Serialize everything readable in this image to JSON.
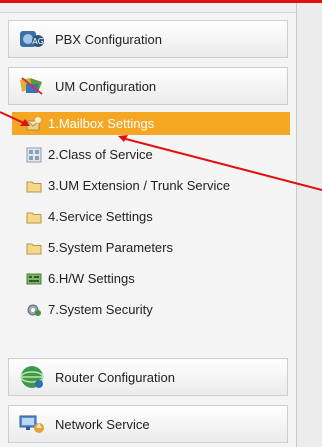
{
  "headers": [
    {
      "label": "PBX Configuration",
      "icon": "pbx-icon"
    },
    {
      "label": "UM Configuration",
      "icon": "um-icon"
    },
    {
      "label": "Router Configuration",
      "icon": "router-icon"
    },
    {
      "label": "Network Service",
      "icon": "network-icon"
    }
  ],
  "um_items": [
    {
      "label": "1.Mailbox Settings",
      "icon": "mailbox-icon",
      "selected": true
    },
    {
      "label": "2.Class of Service",
      "icon": "class-of-service-icon",
      "selected": false
    },
    {
      "label": "3.UM Extension / Trunk Service",
      "icon": "folder-icon",
      "selected": false
    },
    {
      "label": "4.Service Settings",
      "icon": "folder-icon",
      "selected": false
    },
    {
      "label": "5.System Parameters",
      "icon": "folder-icon",
      "selected": false
    },
    {
      "label": "6.H/W Settings",
      "icon": "hardware-icon",
      "selected": false
    },
    {
      "label": "7.System Security",
      "icon": "security-icon",
      "selected": false
    }
  ],
  "colors": {
    "selected_bg": "#f5a623",
    "annotation_arrow": "#e01010"
  }
}
